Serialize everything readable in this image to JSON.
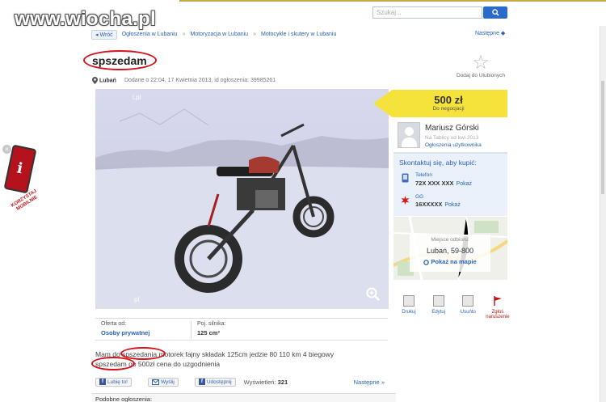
{
  "watermark": "www.wiocha.pl",
  "search": {
    "placeholder": "Szukaj..."
  },
  "breadcrumb": {
    "back": "Wróć",
    "items": [
      "Ogłoszenia w Lubaniu",
      "Motoryzacja w Lubaniu",
      "Motocykle i skutery w Lubaniu"
    ],
    "next": "Następne"
  },
  "ad": {
    "title": "spszedam",
    "city": "Lubań",
    "posted": "Dodane o 22:04, 17 Kwietnia 2013, id ogłoszenia: 39985261",
    "favorite": "Dodaj do Ulubionych",
    "price": "500 zł",
    "price_note": "Do negocjacji",
    "photo_label_top": "l.pl",
    "photo_label_bottom": "pl"
  },
  "seller": {
    "name": "Mariusz Górski",
    "since": "Na Tablicy od kwi 2013",
    "ads_link": "Ogłoszenia użytkownika"
  },
  "contact": {
    "heading": "Skontaktuj się, aby kupić:",
    "phone_label": "Telefon",
    "phone_value": "72X XXX XXX",
    "gg_label": "GG",
    "gg_value": "16XXXXX",
    "show": "Pokaż"
  },
  "map": {
    "label": "Miejsce odbioru:",
    "city": "Lubań, 59-800",
    "link": "Pokaż na mapie"
  },
  "actions": [
    "Drukuj",
    "Edytuj",
    "Usuńto",
    "Zgłoś naruszenie"
  ],
  "details": {
    "offer_label": "Oferta od:",
    "offer_value": "Osoby prywatnej",
    "engine_label": "Poj. silnika:",
    "engine_value": "125 cm³"
  },
  "description": {
    "line1_a": "Mam do ",
    "line1_b": "spszedania",
    "line1_c": " motorek fajny składak 125cm jedzie 80 110 km 4 biegowy",
    "line2_a": "spszedam",
    "line2_b": " go 500zł cena do uzgodnienia"
  },
  "share": {
    "like": "Lubię to!",
    "send": "Wyślij",
    "share": "Udostępnij",
    "views_label": "Wyświetleń:",
    "views_value": "321",
    "next": "Następne »"
  },
  "similar": "Podobne ogłoszenia:",
  "mobile_banner": "KORZYSTAJ MOBILNIE",
  "colors": {
    "accent": "#2a63b6",
    "price_bg": "#f5e33b",
    "highlight": "#d4121a"
  }
}
